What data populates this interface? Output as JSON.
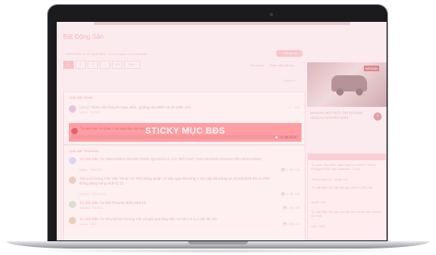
{
  "forum": {
    "page_title": "Bất Động Sản",
    "breadcrumb": [
      "DIỄN ĐÀN Ô TÔ MUA BÁN",
      "Ô tô Finance & Investment"
    ],
    "post_button": "+ Đăng bài",
    "pager": [
      "1",
      "2",
      "3",
      "...",
      "100",
      "Tiếp >"
    ],
    "unread_link": "Chưa đọc",
    "mark_read_link": "Đánh dấu đã đọc",
    "filter_label": "Filters ▾",
    "sticky_header": "CHỦ ĐỀ GHIM",
    "normal_header": "CHỦ ĐỀ THƯỜNG"
  },
  "sticky_label": "STICKY MỤC BĐS",
  "threads_sticky": [
    {
      "title": "Lưu ý: Thảm vấn lồng tin Mua, Bán, Quảng cáo BĐS và tin nhắn mời",
      "meta": "Admin · 12/2017",
      "stats": "12 · 4.1K",
      "avatar_color": "#d9b6d7"
    },
    {
      "prefix": "Tư vấn Đầu Tư",
      "title": "Quản 2 hội nghị đầu vào dòng Top-Lifeline",
      "meta": "by vBinh. 08/07/2017 - 27 bài · 12 bình luận",
      "stats": "💬 121   👁 26.3K",
      "avatar_color": "#cc2530"
    }
  ],
  "threads_normal": [
    {
      "prefix": "Tư vấn Đầu Tư",
      "title": "VINHOMES GRAND PARK QUẬN 9 LÀ CÁI \"BẪY GIÁ\" CHO NHỮNG KHÁCH YẾU BẢN HÓNG",
      "meta": "bigcity · 13/8/2020",
      "stats": "💬 40   👁 5.7K",
      "avatar_color": "#c9d3f0"
    },
    {
      "prefix": "Tìm Lưu Dung",
      "title": "Cần Vấn Thuận An Phố Đông Quận 12 bảo qua Phường 1-Gò Vấp đã thông xe 31/12/2020 Bò An Phố Đông đang nong nhất Q.12",
      "meta": "phoreal · 10/12/2020",
      "stats": "💬 13   👁 3.6K",
      "avatar_color": "#e8c3a7"
    },
    {
      "prefix": "Tư vấn Đầu Tư",
      "title": "Bất Phoenix Biển Nhà bè",
      "meta": "nguyenk · 09/2021",
      "stats": "💬 2   👁 3.9K",
      "avatar_color": "#c5e0c7"
    },
    {
      "prefix": "Tư vấn Đầu Tư",
      "title": "Khu Đô thị Vương Cát Lái giờ quá thay đổi, có hội + 2,3,4 cần lãi sâu",
      "meta": "hoang · 2021",
      "stats": "💬 2   👁 1.1K",
      "avatar_color": "#e1c7a1"
    }
  ],
  "sidebar": {
    "ad_badge": "NISSAN",
    "ad_text": "MẠN RA MẮT ĐẦY ẤN TƯỢNG NISSAN NAVARA 2021",
    "items": [
      {
        "prefix": "",
        "text": "Tư phức đầu BĐS, năm nay Tự, Crave 7.45 bộ Peugeot 2008 bảy Outlander 2.5 số"
      },
      {
        "prefix": "",
        "text": "Tường Miết Tô · Chấp con"
      },
      {
        "prefix": "Tư vấn Đầu Tư",
        "text": "Cấu tiểu gia, Định vị đất phải"
      },
      {
        "prefix": "",
        "text": "quyên nhà ·"
      },
      {
        "prefix": "Tư vấn Đầu Tư",
        "text": "Làm sao để chọn được căn nhà có tốt nhất"
      },
      {
        "prefix": "",
        "text": "nhà · 2021"
      }
    ]
  }
}
